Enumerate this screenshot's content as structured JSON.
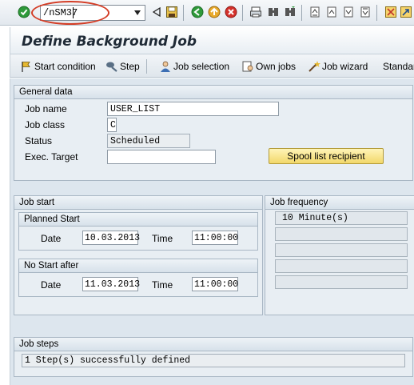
{
  "toolbar": {
    "command_value": "/nSM37",
    "icons": [
      "enter-icon",
      "command-dropdown-icon",
      "back-triangle-icon",
      "save-icon",
      "back-icon",
      "exit-icon",
      "cancel-icon",
      "print-icon",
      "find-icon",
      "find-next-icon",
      "first-page-icon",
      "previous-page-icon",
      "next-page-icon",
      "last-page-icon",
      "create-session-icon",
      "shortcut-icon"
    ]
  },
  "title": "Define Background Job",
  "app_toolbar": {
    "start_condition": "Start condition",
    "step": "Step",
    "job_selection": "Job selection",
    "own_jobs": "Own jobs",
    "job_wizard": "Job wizard",
    "standard": "Standar"
  },
  "general": {
    "title": "General data",
    "job_name_label": "Job name",
    "job_name_value": "USER_LIST",
    "job_class_label": "Job class",
    "job_class_value": "C",
    "status_label": "Status",
    "status_value": "Scheduled",
    "exec_target_label": "Exec. Target",
    "exec_target_value": "",
    "spool_button": "Spool list recipient"
  },
  "job_start": {
    "title": "Job start",
    "planned": {
      "title": "Planned Start",
      "date_label": "Date",
      "date_value": "10.03.2013",
      "time_label": "Time",
      "time_value": "11:00:00"
    },
    "no_start_after": {
      "title": "No Start after",
      "date_label": "Date",
      "date_value": "11.03.2013",
      "time_label": "Time",
      "time_value": "11:00:00"
    }
  },
  "job_frequency": {
    "title": "Job frequency",
    "rows": [
      "10 Minute(s)",
      "",
      "",
      "",
      ""
    ]
  },
  "job_steps": {
    "title": "Job steps",
    "message": "1 Step(s) successfully defined"
  },
  "colors": {
    "accent_red": "#d33c25",
    "button_yellow": "#f2d86a",
    "panel_blue": "#dde6ee"
  }
}
